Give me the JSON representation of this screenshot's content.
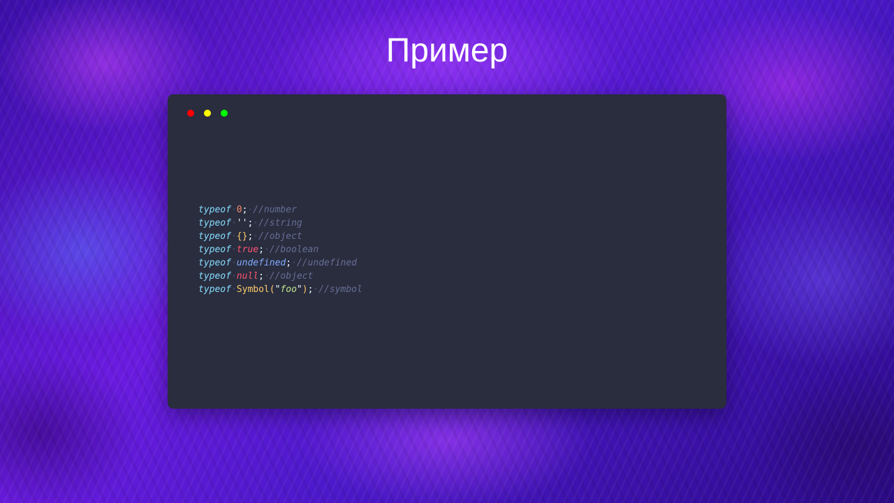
{
  "slide": {
    "title": "Пример"
  },
  "window": {
    "controls": [
      "close-dot",
      "minimize-dot",
      "maximize-dot"
    ],
    "colors": {
      "background": "#292d3e",
      "close": "#ff0000",
      "minimize": "#ffff00",
      "maximize": "#00ff00"
    }
  },
  "code": {
    "lines": [
      {
        "typeof": "typeof",
        "sep1": "·",
        "value": "0",
        "semi": ";",
        "sep2": "·",
        "comment": "//number"
      },
      {
        "typeof": "typeof",
        "sep1": "·",
        "value": "''",
        "semi": ";",
        "sep2": "·",
        "comment": "//string"
      },
      {
        "typeof": "typeof",
        "sep1": "·",
        "value": "{}",
        "semi": ";",
        "sep2": "·",
        "comment": "//object"
      },
      {
        "typeof": "typeof",
        "sep1": "·",
        "value": "true",
        "semi": ";",
        "sep2": "·",
        "comment": "//boolean"
      },
      {
        "typeof": "typeof",
        "sep1": "·",
        "value": "undefined",
        "semi": ";",
        "sep2": "·",
        "comment": "//undefined"
      },
      {
        "typeof": "typeof",
        "sep1": "·",
        "value": "null",
        "semi": ";",
        "sep2": "·",
        "comment": "//object"
      },
      {
        "typeof": "typeof",
        "sep1": "·",
        "fn": "Symbol(",
        "q1": "\"",
        "arg": "foo",
        "q2": "\"",
        "close": ")",
        "semi": ";",
        "sep2": "·",
        "comment": "//symbol"
      }
    ]
  }
}
